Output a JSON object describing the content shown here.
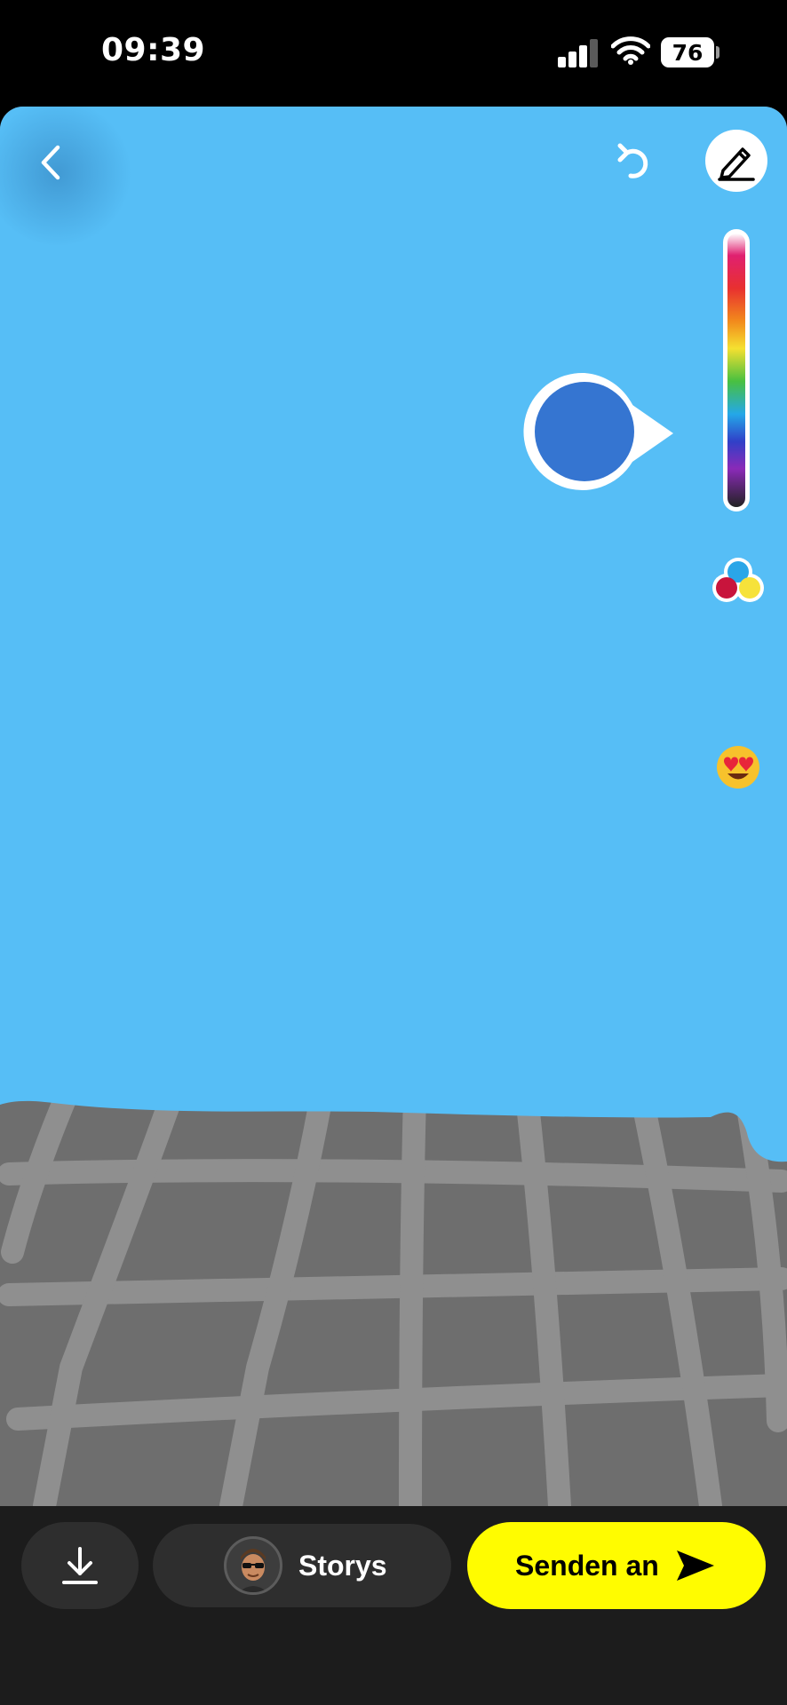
{
  "status_bar": {
    "time": "09:39",
    "battery_level": "76",
    "signal_bars_active": 3,
    "signal_bars_total": 4
  },
  "editor": {
    "tools": {
      "back_icon": "chevron-left-icon",
      "undo_icon": "undo-icon",
      "pen_icon": "pen-icon",
      "palette_icon": "color-palette-icon",
      "emoji_icon": "heart-eyes-emoji-icon"
    },
    "colors": {
      "drawing_fill": "#56bef6",
      "selected_color": "#3575d1",
      "road_surface": "#6e6e6e",
      "grid_lines": "#8f8f8f"
    },
    "emoji": "😍"
  },
  "bottom_bar": {
    "download_icon": "download-icon",
    "story_label": "Storys",
    "send_label": "Senden an",
    "send_icon": "send-arrow-icon",
    "send_color": "#fffc00"
  }
}
